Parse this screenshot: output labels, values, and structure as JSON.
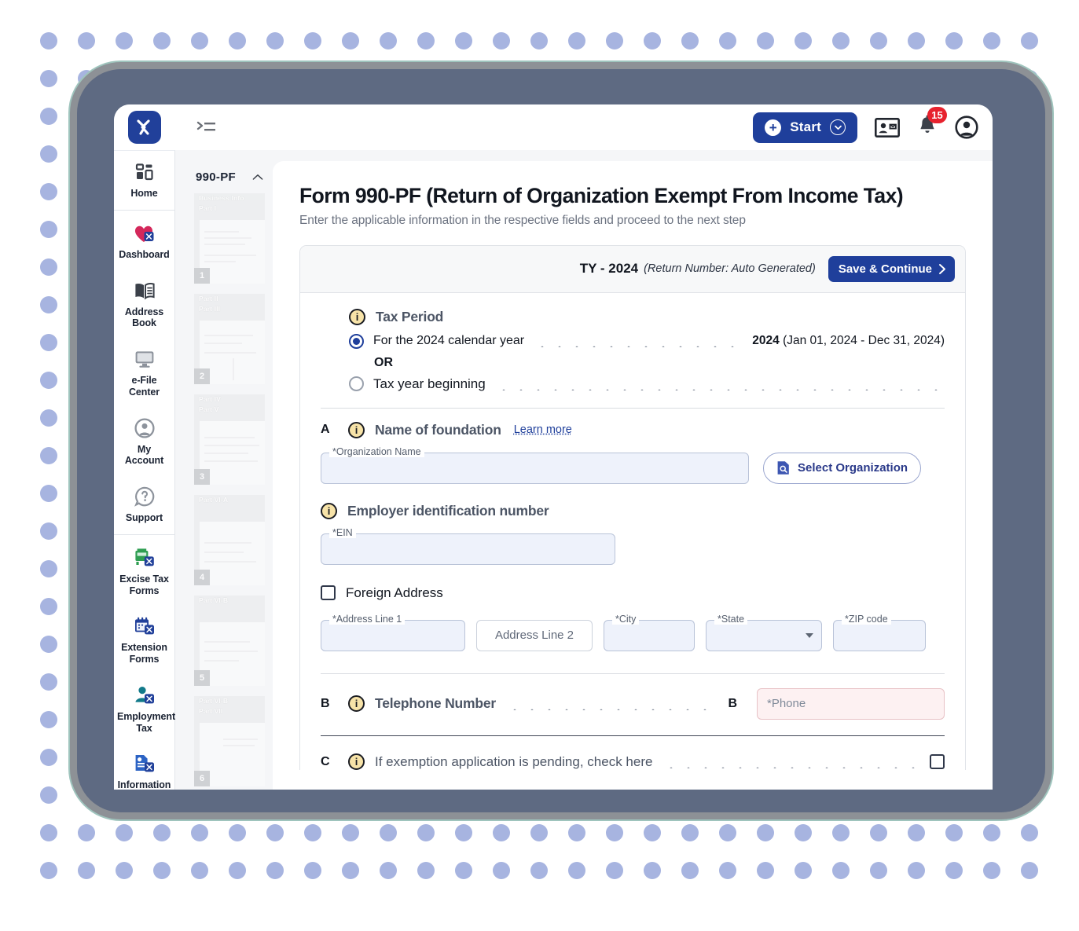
{
  "app": {
    "logo_text": "X",
    "collapse_icon": "expand-sidebar-icon"
  },
  "topbar": {
    "start_label": "Start",
    "start_plus_icon": "plus-circle-icon",
    "start_caret_icon": "chevron-down-circle-icon",
    "contact_card_icon": "contact-card-icon",
    "notification_icon": "bell-icon",
    "notification_count": "15",
    "account_icon": "user-circle-icon"
  },
  "rail": {
    "items": [
      {
        "label": "Home",
        "icon": "grid-dashboard-icon"
      },
      {
        "label": "Dashboard",
        "icon": "heart-tax-icon"
      },
      {
        "label": "Address Book",
        "icon": "address-book-icon"
      },
      {
        "label": "e-File Center",
        "icon": "monitor-icon"
      },
      {
        "label": "My Account",
        "icon": "user-circle-icon"
      },
      {
        "label": "Support",
        "icon": "question-bubble-icon"
      },
      {
        "label": "Excise Tax Forms",
        "icon": "truck-tax-icon"
      },
      {
        "label": "Extension Forms",
        "icon": "calendar-tax-icon"
      },
      {
        "label": "Employment Tax",
        "icon": "person-tax-icon"
      },
      {
        "label": "Information Returns",
        "icon": "document-tax-icon"
      }
    ]
  },
  "thumbnails": {
    "title": "990-PF",
    "collapse_icon": "chevron-up-icon",
    "pages": [
      {
        "number": "1",
        "sections": [
          "Business Info",
          "Part I"
        ]
      },
      {
        "number": "2",
        "sections": [
          "Part II",
          "Part III"
        ]
      },
      {
        "number": "3",
        "sections": [
          "Part IV",
          "Part V"
        ]
      },
      {
        "number": "4",
        "sections": [
          "Part VI-A"
        ]
      },
      {
        "number": "5",
        "sections": [
          "Part VI-B"
        ]
      },
      {
        "number": "6",
        "sections": [
          "Part VI-B",
          "Part VII"
        ]
      }
    ]
  },
  "form": {
    "title": "Form 990-PF (Return of Organization Exempt From Income Tax)",
    "subtitle": "Enter the applicable information in the respective fields and proceed to the next step",
    "panel_header": {
      "ty_label": "TY - 2024",
      "return_note": "(Return Number: Auto Generated)",
      "save_label": "Save & Continue",
      "save_caret_icon": "chevron-right-icon"
    },
    "tax_period": {
      "info_icon": "info-icon",
      "title": "Tax Period",
      "option_calendar": {
        "label": "For the 2024 calendar year",
        "year": "2024",
        "range": "(Jan 01, 2024 - Dec 31, 2024)",
        "selected": true
      },
      "or_text": "OR",
      "option_beginning": {
        "label": "Tax year beginning",
        "selected": false
      }
    },
    "section_a": {
      "letter": "A",
      "info_icon": "info-icon",
      "title": "Name of foundation",
      "learn_more": "Learn more",
      "org_name_label": "*Organization Name",
      "org_name_value": "",
      "select_org_label": "Select Organization",
      "select_org_icon": "document-search-icon"
    },
    "ein": {
      "info_icon": "info-icon",
      "title": "Employer identification number",
      "label": "*EIN",
      "value": ""
    },
    "address": {
      "foreign_checkbox_label": "Foreign Address",
      "foreign_checked": false,
      "line1_label": "*Address Line 1",
      "line1_value": "",
      "line2_placeholder": "Address Line 2",
      "line2_value": "",
      "city_label": "*City",
      "city_value": "",
      "state_label": "*State",
      "state_value": "",
      "state_caret_icon": "chevron-down-icon",
      "zip_label": "*ZIP code",
      "zip_value": ""
    },
    "section_b": {
      "letter": "B",
      "letter_right": "B",
      "info_icon": "info-icon",
      "title": "Telephone Number",
      "phone_placeholder": "*Phone",
      "phone_value": ""
    },
    "section_c": {
      "letter": "C",
      "info_icon": "info-icon",
      "title": "If exemption application is pending, check here",
      "checked": false
    }
  },
  "colors": {
    "brand_blue": "#1f3f9b",
    "badge_red": "#e7222e",
    "info_amber": "#f7e3a8",
    "field_fill": "#eef2fb",
    "error_fill": "#fdf1f2",
    "frame": "#5e6a82",
    "dot": "#a7b4e0"
  }
}
